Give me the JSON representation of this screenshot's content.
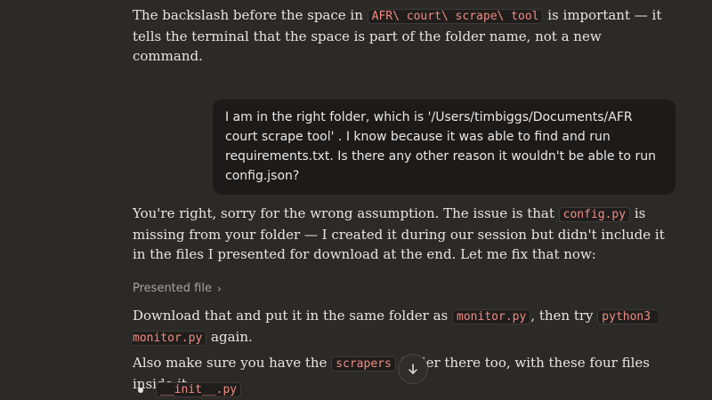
{
  "assistant_1": {
    "pre": "The backslash before the space in ",
    "code": "AFR\\ court\\ scrape\\ tool",
    "post": " is important — it tells the terminal that the space is part of the folder name, not a new command."
  },
  "user_message": {
    "text": "I am in the right folder, which is '/Users/timbiggs/Documents/AFR court scrape tool' . I know because it was able to find and run requirements.txt. Is there any other reason it wouldn't be able to run config.json?"
  },
  "assistant_2": {
    "pre": "You're right, sorry for the wrong assumption. The issue is that ",
    "code": "config.py",
    "post": " is missing from your folder — I created it during our session but didn't include it in the files I presented for download at the end. Let me fix that now:"
  },
  "presented_file": {
    "label": "Presented file",
    "chevron": "›"
  },
  "assistant_3": {
    "pre": "Download that and put it in the same folder as ",
    "code1": "monitor.py",
    "mid": ", then try ",
    "code2": "python3 monitor.py",
    "post": " again."
  },
  "assistant_4": {
    "pre": "Also make sure you have the ",
    "code": "scrapers",
    "post": " folder there too, with these four files inside it:"
  },
  "bullet_1": {
    "code": "__init__.py"
  }
}
